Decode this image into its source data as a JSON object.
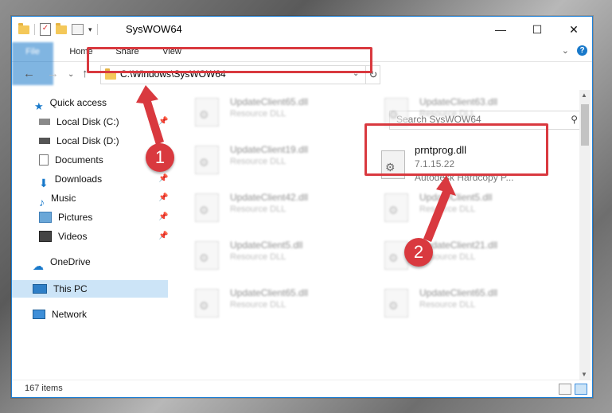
{
  "window": {
    "title": "SysWOW64",
    "minimize": "—",
    "maximize": "☐",
    "close": "✕"
  },
  "ribbon": {
    "tabs": [
      "File",
      "Home",
      "Share",
      "View"
    ]
  },
  "nav": {
    "address": "C:\\Windows\\SysWOW64",
    "search_placeholder": "Search SysWOW64"
  },
  "sidebar": {
    "items": [
      {
        "label": "Quick access",
        "icon": "star-icon",
        "pinned": false
      },
      {
        "label": "Local Disk (C:)",
        "icon": "drive-icon",
        "pinned": true
      },
      {
        "label": "Local Disk (D:)",
        "icon": "drive-icon",
        "pinned": false
      },
      {
        "label": "Documents",
        "icon": "document-icon",
        "pinned": true
      },
      {
        "label": "Downloads",
        "icon": "download-icon",
        "pinned": true
      },
      {
        "label": "Music",
        "icon": "music-icon",
        "pinned": true
      },
      {
        "label": "Pictures",
        "icon": "pictures-icon",
        "pinned": true
      },
      {
        "label": "Videos",
        "icon": "video-icon",
        "pinned": true
      },
      {
        "label": "OneDrive",
        "icon": "cloud-icon",
        "pinned": false
      },
      {
        "label": "This PC",
        "icon": "computer-icon",
        "pinned": false
      },
      {
        "label": "Network",
        "icon": "network-icon",
        "pinned": false
      }
    ]
  },
  "files": [
    {
      "name": "UpdateClient65.dll",
      "desc": "Resource DLL"
    },
    {
      "name": "UpdateClient63.dll",
      "desc": "Resource DLL"
    },
    {
      "name": "UpdateClient19.dll",
      "desc": "Resource DLL"
    },
    {
      "name": "UpdateClient42.dll",
      "desc": "Resource DLL"
    },
    {
      "name": "UpdateClient5.dll",
      "desc": "Resource DLL"
    },
    {
      "name": "UpdateClient21.dll",
      "desc": "Resource DLL"
    },
    {
      "name": "UpdateClient65.dll",
      "desc": "Resource DLL"
    },
    {
      "name": "UpdateClient65.dll",
      "desc": "Resource DLL"
    }
  ],
  "selected_file": {
    "name": "prntprog.dll",
    "version": "7.1.15.22",
    "company": "Autodesk Hardcopy P..."
  },
  "status": {
    "item_count": "167 items"
  },
  "markers": {
    "step1": "1",
    "step2": "2"
  },
  "colors": {
    "accent": "#1979ca",
    "highlight": "#d9393f",
    "selection": "#cce4f7"
  }
}
